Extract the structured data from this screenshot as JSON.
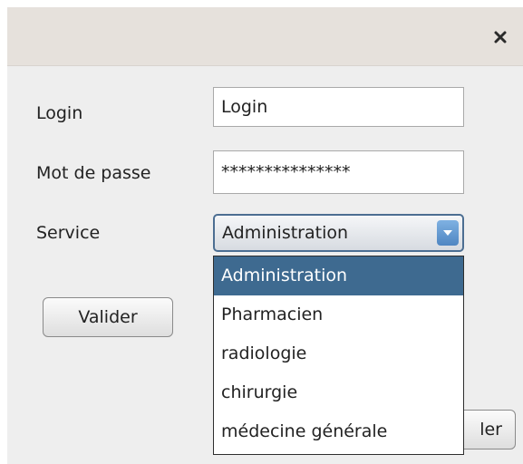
{
  "window": {
    "close_icon": "close-icon"
  },
  "form": {
    "login_label": "Login",
    "login_value": "Login",
    "password_label": "Mot de passe",
    "password_value": "***************",
    "service_label": "Service",
    "service_selected": "Administration",
    "service_options": [
      "Administration",
      "Pharmacien",
      "radiologie",
      "chirurgie",
      "médecine générale"
    ]
  },
  "buttons": {
    "validate_label": "Valider",
    "cancel_label_visible": "ler"
  },
  "colors": {
    "selected_item_bg": "#3e6a90",
    "combo_border": "#4c6e92",
    "arrow_blue": "#5a8fc9"
  }
}
